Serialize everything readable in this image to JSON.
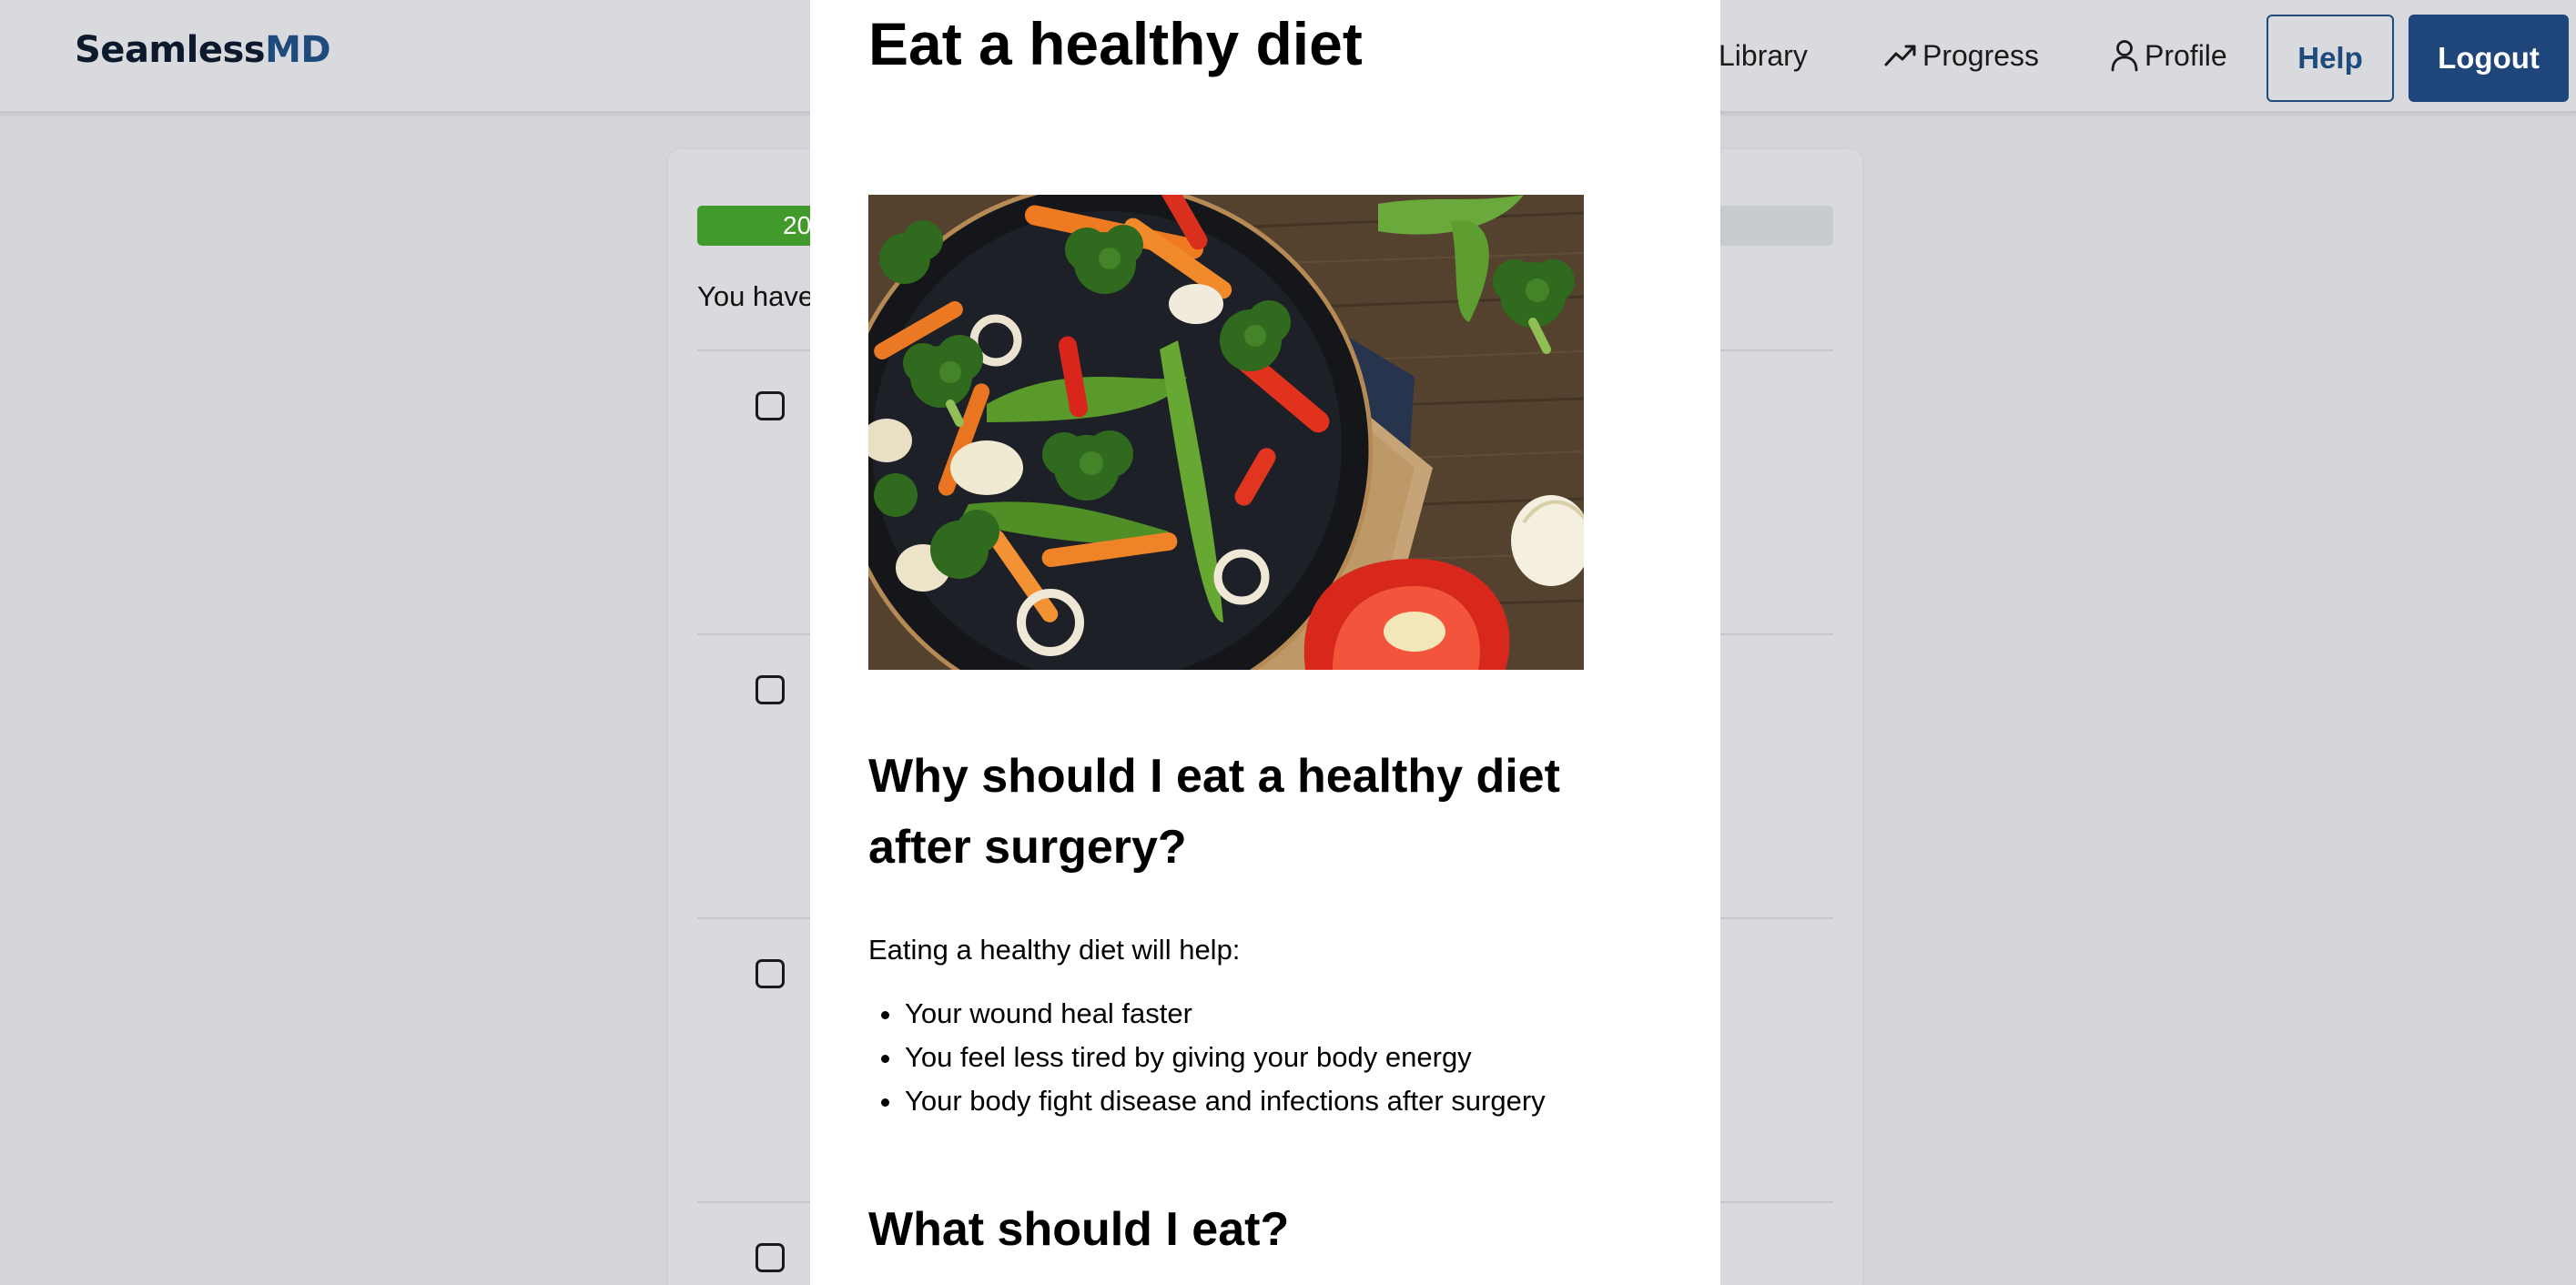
{
  "brand": {
    "name_part1": "Seamless",
    "name_part2": "MD"
  },
  "nav": {
    "library": {
      "label": "Library"
    },
    "progress": {
      "label": "Progress",
      "icon": "trending-up-icon"
    },
    "profile": {
      "label": "Profile",
      "icon": "user-icon"
    }
  },
  "actions": {
    "help_label": "Help",
    "logout_label": "Logout"
  },
  "colors": {
    "brand_blue": "#1e467b",
    "progress_green": "#419a2a",
    "overlay_bg": "#d4d5d8",
    "modal_bg": "#ffffff"
  },
  "task_panel": {
    "progress_text": "20",
    "progress_fraction": 0.2,
    "summary_prefix": "You have"
  },
  "article": {
    "title": "Eat a healthy diet",
    "image_subject": "vegetable stir-fry bowl",
    "why_heading": "Why should I eat a healthy diet after surgery?",
    "intro": "Eating a healthy diet will help:",
    "benefits": [
      "Your wound heal faster",
      "You feel less tired by giving your body energy",
      "Your body fight disease and infections after surgery"
    ],
    "what_heading": "What should I eat?"
  }
}
